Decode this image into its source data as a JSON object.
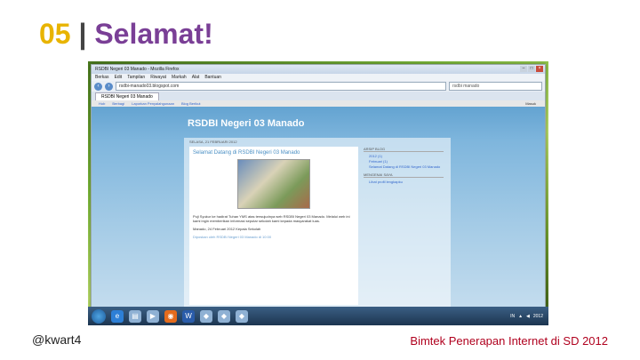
{
  "slide": {
    "number": "05",
    "separator": "|",
    "title": "Selamat!",
    "author": "@kwart4",
    "event": "Bimtek Penerapan Internet di SD 2012"
  },
  "browser": {
    "window_title": "RSDBI Negeri 03 Manado - Mozilla Firefox",
    "menu": [
      "Berkas",
      "Edit",
      "Tampilan",
      "Riwayat",
      "Markah",
      "Alat",
      "Bantuan"
    ],
    "url": "rsdbi-manado03.blogspot.com",
    "search_placeholder": "rsdbi manado",
    "tab_label": "RSDBI Negeri 03 Manado"
  },
  "blogger_bar": {
    "links": [
      "Hob",
      "Berbagi",
      "Laporkan Penyalahgunaan",
      "Blog Berikut"
    ],
    "account": "Masuk"
  },
  "blog": {
    "title": "RSDBI Negeri 03 Manado",
    "date_header": "SELASA, 21 FEBRUARI 2012",
    "post_title": "Selamat Datang di RSDBI Negeri 03 Manado",
    "post_body": "Puji Syukur ke hadirat Tuhan YMS atas terwujudnya web RSDBI Negeri 03 Manado. Melalui web ini kami ingin memberikan informasi seputar sekolah kami kepada masyarakat luas.",
    "post_sign": "Manado, 24 Februari 2012 Kepala Sekolah",
    "post_footer": "Diposkan oleh RSDBI Negeri 03 Manado di 10:00",
    "sidebar": {
      "archive_heading": "ARSIP BLOG",
      "archive_year": "2012 (1)",
      "archive_month": "Februari (1)",
      "archive_post": "Selamat Datang di RSDBI Negeri 03 Manado",
      "profile_heading": "MENGENAI SAYA",
      "profile_link": "Lihat profil lengkapku"
    }
  },
  "taskbar": {
    "icons": [
      "ie-icon",
      "explorer-icon",
      "media-icon",
      "firefox-icon",
      "word-icon",
      "app-icon",
      "app-icon",
      "app-icon"
    ],
    "time": "2012",
    "lang": "IN"
  }
}
